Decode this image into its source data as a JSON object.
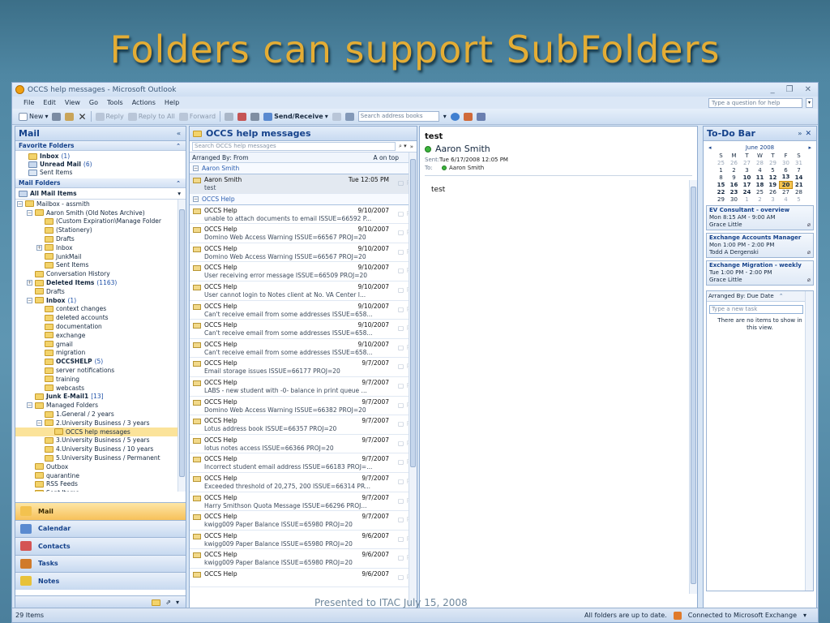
{
  "slide": {
    "title": "Folders can support SubFolders",
    "footnote": "Presented to ITAC July 15, 2008"
  },
  "window": {
    "title": "OCCS help messages - Microsoft Outlook",
    "controls": [
      "_",
      "❐",
      "✕"
    ]
  },
  "menu": {
    "items": [
      "File",
      "Edit",
      "View",
      "Go",
      "Tools",
      "Actions",
      "Help"
    ],
    "help_placeholder": "Type a question for help"
  },
  "toolbar": {
    "new": "New",
    "reply": "Reply",
    "reply_all": "Reply to All",
    "forward": "Forward",
    "send_receive": "Send/Receive",
    "address_placeholder": "Search address books"
  },
  "nav": {
    "title": "Mail",
    "favorites_header": "Favorite Folders",
    "favorites": [
      {
        "label": "Inbox",
        "count": "(1)"
      },
      {
        "label": "Unread Mail",
        "count": "(6)"
      },
      {
        "label": "Sent Items",
        "count": ""
      }
    ],
    "mail_folders_header": "Mail Folders",
    "all_mail": "All Mail Items",
    "tree": [
      {
        "label": "Mailbox - assmith",
        "count": "",
        "indent": 0,
        "exp": "−",
        "bold": false
      },
      {
        "label": "Aaron Smith (Old Notes Archive)",
        "count": "",
        "indent": 1,
        "exp": "−",
        "bold": false
      },
      {
        "label": "(Custom Expiration\\Manage Folder",
        "count": "",
        "indent": 2,
        "exp": "",
        "bold": false
      },
      {
        "label": "(Stationery)",
        "count": "",
        "indent": 2,
        "exp": "",
        "bold": false
      },
      {
        "label": "Drafts",
        "count": "",
        "indent": 2,
        "exp": "",
        "bold": false
      },
      {
        "label": "Inbox",
        "count": "",
        "indent": 2,
        "exp": "+",
        "bold": false
      },
      {
        "label": "JunkMail",
        "count": "",
        "indent": 2,
        "exp": "",
        "bold": false
      },
      {
        "label": "Sent Items",
        "count": "",
        "indent": 2,
        "exp": "",
        "bold": false
      },
      {
        "label": "Conversation History",
        "count": "",
        "indent": 1,
        "exp": "",
        "bold": false
      },
      {
        "label": "Deleted Items",
        "count": "(1163)",
        "indent": 1,
        "exp": "+",
        "bold": true
      },
      {
        "label": "Drafts",
        "count": "",
        "indent": 1,
        "exp": "",
        "bold": false
      },
      {
        "label": "Inbox",
        "count": "(1)",
        "indent": 1,
        "exp": "−",
        "bold": true
      },
      {
        "label": "context changes",
        "count": "",
        "indent": 2,
        "exp": "",
        "bold": false
      },
      {
        "label": "deleted accounts",
        "count": "",
        "indent": 2,
        "exp": "",
        "bold": false
      },
      {
        "label": "documentation",
        "count": "",
        "indent": 2,
        "exp": "",
        "bold": false
      },
      {
        "label": "exchange",
        "count": "",
        "indent": 2,
        "exp": "",
        "bold": false
      },
      {
        "label": "gmail",
        "count": "",
        "indent": 2,
        "exp": "",
        "bold": false
      },
      {
        "label": "migration",
        "count": "",
        "indent": 2,
        "exp": "",
        "bold": false
      },
      {
        "label": "OCCSHELP",
        "count": "(5)",
        "indent": 2,
        "exp": "",
        "bold": true
      },
      {
        "label": "server notifications",
        "count": "",
        "indent": 2,
        "exp": "",
        "bold": false
      },
      {
        "label": "training",
        "count": "",
        "indent": 2,
        "exp": "",
        "bold": false
      },
      {
        "label": "webcasts",
        "count": "",
        "indent": 2,
        "exp": "",
        "bold": false
      },
      {
        "label": "Junk E-Mail1",
        "count": "[13]",
        "indent": 1,
        "exp": "",
        "bold": true
      },
      {
        "label": "Managed Folders",
        "count": "",
        "indent": 1,
        "exp": "−",
        "bold": false
      },
      {
        "label": "1.General / 2 years",
        "count": "",
        "indent": 2,
        "exp": "",
        "bold": false
      },
      {
        "label": "2.University Business / 3 years",
        "count": "",
        "indent": 2,
        "exp": "−",
        "bold": false
      },
      {
        "label": "OCCS help messages",
        "count": "",
        "indent": 3,
        "exp": "",
        "bold": false,
        "selected": true
      },
      {
        "label": "3.University Business / 5 years",
        "count": "",
        "indent": 2,
        "exp": "",
        "bold": false
      },
      {
        "label": "4.University Business / 10 years",
        "count": "",
        "indent": 2,
        "exp": "",
        "bold": false
      },
      {
        "label": "5.University Business / Permanent",
        "count": "",
        "indent": 2,
        "exp": "",
        "bold": false
      },
      {
        "label": "Outbox",
        "count": "",
        "indent": 1,
        "exp": "",
        "bold": false
      },
      {
        "label": "quarantine",
        "count": "",
        "indent": 1,
        "exp": "",
        "bold": false
      },
      {
        "label": "RSS Feeds",
        "count": "",
        "indent": 1,
        "exp": "",
        "bold": false
      },
      {
        "label": "Sent Items",
        "count": "",
        "indent": 1,
        "exp": "",
        "bold": false
      }
    ],
    "buttons": [
      "Mail",
      "Calendar",
      "Contacts",
      "Tasks",
      "Notes"
    ]
  },
  "list": {
    "title": "OCCS help messages",
    "search_placeholder": "Search OCCS help messages",
    "arranged_by": "Arranged By: From",
    "order": "A on top",
    "groups": [
      {
        "name": "Aaron Smith",
        "messages": [
          {
            "from": "Aaron Smith",
            "date": "Tue 12:05 PM",
            "subject": "test",
            "selected": true
          }
        ]
      },
      {
        "name": "OCCS Help",
        "messages": [
          {
            "from": "OCCS Help",
            "date": "9/10/2007",
            "subject": "unable to attach documents to email ISSUE=66592 P..."
          },
          {
            "from": "OCCS Help",
            "date": "9/10/2007",
            "subject": "Domino Web Access Warning ISSUE=66567 PROJ=20"
          },
          {
            "from": "OCCS Help",
            "date": "9/10/2007",
            "subject": "Domino Web Access Warning ISSUE=66567 PROJ=20"
          },
          {
            "from": "OCCS Help",
            "date": "9/10/2007",
            "subject": "User receiving error message ISSUE=66509 PROJ=20"
          },
          {
            "from": "OCCS Help",
            "date": "9/10/2007",
            "subject": "User cannot login to Notes client at No. VA Center I..."
          },
          {
            "from": "OCCS Help",
            "date": "9/10/2007",
            "subject": "Can't receive email from some addresses ISSUE=658..."
          },
          {
            "from": "OCCS Help",
            "date": "9/10/2007",
            "subject": "Can't receive email from some addresses ISSUE=658..."
          },
          {
            "from": "OCCS Help",
            "date": "9/10/2007",
            "subject": "Can't receive email from some addresses ISSUE=658..."
          },
          {
            "from": "OCCS Help",
            "date": "9/7/2007",
            "subject": "Email storage issues ISSUE=66177 PROJ=20"
          },
          {
            "from": "OCCS Help",
            "date": "9/7/2007",
            "subject": "LABS - new student with -0- balance in print queue ..."
          },
          {
            "from": "OCCS Help",
            "date": "9/7/2007",
            "subject": "Domino Web Access Warning ISSUE=66382 PROJ=20"
          },
          {
            "from": "OCCS Help",
            "date": "9/7/2007",
            "subject": "Lotus address book ISSUE=66357 PROJ=20"
          },
          {
            "from": "OCCS Help",
            "date": "9/7/2007",
            "subject": "lotus notes access ISSUE=66366 PROJ=20"
          },
          {
            "from": "OCCS Help",
            "date": "9/7/2007",
            "subject": "Incorrect student email address ISSUE=66183 PROJ=..."
          },
          {
            "from": "OCCS Help",
            "date": "9/7/2007",
            "subject": "Exceeded threshold of 20,275, 200 ISSUE=66314 PR..."
          },
          {
            "from": "OCCS Help",
            "date": "9/7/2007",
            "subject": "Harry Smithson Quota Message ISSUE=66296 PROJ..."
          },
          {
            "from": "OCCS Help",
            "date": "9/7/2007",
            "subject": "kwigg009 Paper Balance ISSUE=65980 PROJ=20"
          },
          {
            "from": "OCCS Help",
            "date": "9/6/2007",
            "subject": "kwigg009 Paper Balance ISSUE=65980 PROJ=20"
          },
          {
            "from": "OCCS Help",
            "date": "9/6/2007",
            "subject": "kwigg009 Paper Balance ISSUE=65980 PROJ=20"
          },
          {
            "from": "OCCS Help",
            "date": "9/6/2007",
            "subject": ""
          }
        ]
      }
    ]
  },
  "reading": {
    "subject": "test",
    "sender": "Aaron Smith",
    "sent_label": "Sent:",
    "sent": "Tue 6/17/2008 12:05 PM",
    "to_label": "To:",
    "to": "Aaron Smith",
    "body": "test"
  },
  "todo": {
    "title": "To-Do Bar",
    "month": "June 2008",
    "weekdays": [
      "S",
      "M",
      "T",
      "W",
      "T",
      "F",
      "S"
    ],
    "weeks": [
      [
        "25",
        "26",
        "27",
        "28",
        "29",
        "30",
        "31"
      ],
      [
        "1",
        "2",
        "3",
        "4",
        "5",
        "6",
        "7"
      ],
      [
        "8",
        "9",
        "10",
        "11",
        "12",
        "13",
        "14"
      ],
      [
        "15",
        "16",
        "17",
        "18",
        "19",
        "20",
        "21"
      ],
      [
        "22",
        "23",
        "24",
        "25",
        "26",
        "27",
        "28"
      ],
      [
        "29",
        "30",
        "1",
        "2",
        "3",
        "4",
        "5"
      ]
    ],
    "today": "20",
    "appointments": [
      {
        "title": "EV Consultant - overview",
        "time": "Mon 8:15 AM - 9:00 AM",
        "who": "Grace Little"
      },
      {
        "title": "Exchange Accounts Manager",
        "time": "Mon 1:00 PM - 2:00 PM",
        "who": "Todd A Dergenski"
      },
      {
        "title": "Exchange Migration - weekly",
        "time": "Tue 1:00 PM - 2:00 PM",
        "who": "Grace Little"
      }
    ],
    "tasks_arranged": "Arranged By: Due Date",
    "new_task_placeholder": "Type a new task",
    "empty": "There are no items to show in this view."
  },
  "status": {
    "items": "29 Items",
    "sync": "All folders are up to date.",
    "connection": "Connected to Microsoft Exchange"
  }
}
